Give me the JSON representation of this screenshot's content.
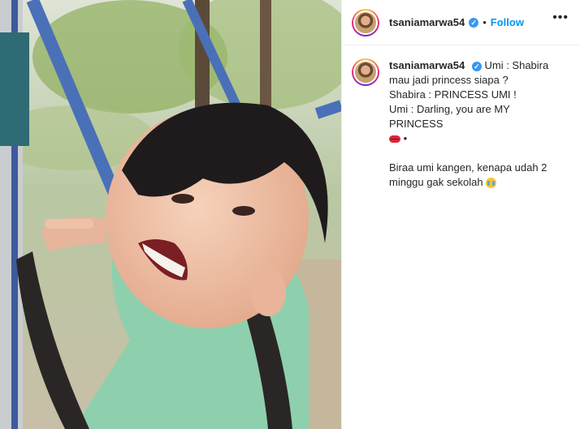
{
  "post": {
    "username": "tsaniamarwa54",
    "verified": true,
    "separator": "•",
    "follow_label": "Follow",
    "more_icon": "more-horizontal-icon"
  },
  "caption": {
    "username": "tsaniamarwa54",
    "line1": "Umi : Shabira mau jadi princess siapa ?",
    "line2": "Shabira : PRINCESS UMI !",
    "line3": "Umi : Darling, you are MY PRINCESS",
    "line3_tail": "•",
    "line4": "Biraa umi kangen, kenapa udah 2 minggu gak sekolah",
    "emoji1": "kiss-lips-emoji",
    "emoji2": "crying-face-emoji"
  },
  "colors": {
    "accent": "#0095f6",
    "verified": "#3897f0",
    "text": "#262626",
    "border": "#efefef"
  },
  "media": {
    "description_icon": "video-frame"
  }
}
